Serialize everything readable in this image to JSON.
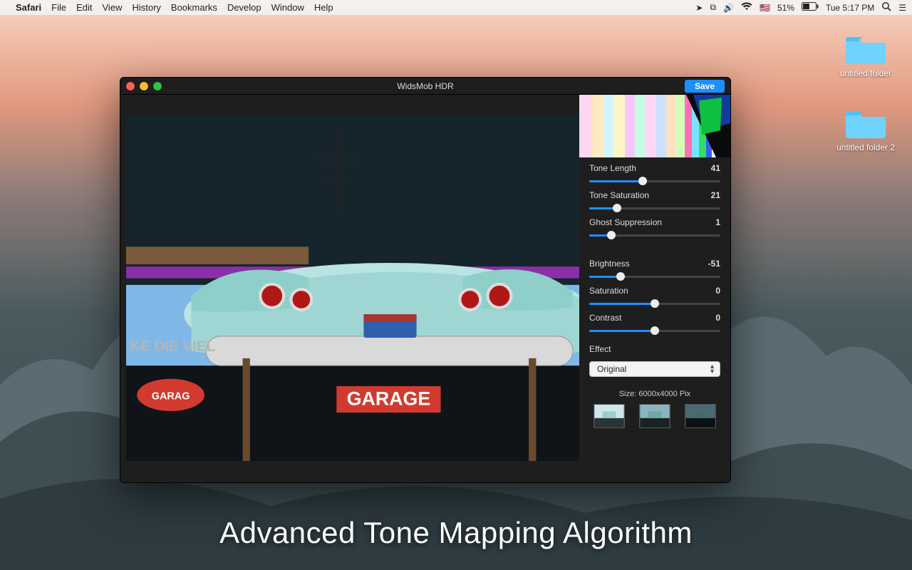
{
  "menubar": {
    "app": "Safari",
    "items": [
      "File",
      "Edit",
      "View",
      "History",
      "Bookmarks",
      "Develop",
      "Window",
      "Help"
    ],
    "battery_pct": "51%",
    "clock": "Tue 5:17 PM",
    "flag": "🇺🇸"
  },
  "desktop": {
    "folders": [
      {
        "label": "untitled folder"
      },
      {
        "label": "untitled folder 2"
      }
    ]
  },
  "window": {
    "title": "WidsMob HDR",
    "save_label": "Save"
  },
  "controls": {
    "tone_length": {
      "label": "Tone Length",
      "value": "41",
      "pct": 41
    },
    "tone_saturation": {
      "label": "Tone Saturation",
      "value": "21",
      "pct": 21
    },
    "ghost_suppression": {
      "label": "Ghost Suppression",
      "value": "1",
      "pct": 17
    },
    "brightness": {
      "label": "Brightness",
      "value": "-51",
      "pct": 24
    },
    "saturation": {
      "label": "Saturation",
      "value": "0",
      "pct": 50
    },
    "contrast": {
      "label": "Contrast",
      "value": "0",
      "pct": 50
    }
  },
  "effect": {
    "label": "Effect",
    "selected": "Original"
  },
  "size_info": "Size: 6000x4000 Pix",
  "promo_text": "Advanced Tone Mapping Algorithm"
}
